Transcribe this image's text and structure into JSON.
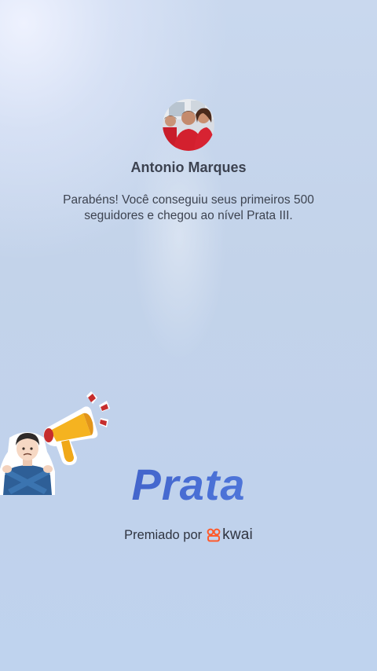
{
  "profile": {
    "name": "Antonio Marques",
    "avatar_icon": "profile-photo"
  },
  "message": {
    "line1": "Parabéns! Você conseguiu seus primeiros 500",
    "line2": "seguidores e chegou ao nível Prata III."
  },
  "level": {
    "title": "Prata",
    "color": "#3d5fc4"
  },
  "award": {
    "prefix": "Premiado por",
    "brand_name": "kwai",
    "brand_icon": "kwai-logo-icon",
    "brand_color": "#ff5a2b"
  },
  "stickers": [
    {
      "icon": "person-crossing-arms-icon"
    },
    {
      "icon": "megaphone-icon"
    }
  ]
}
